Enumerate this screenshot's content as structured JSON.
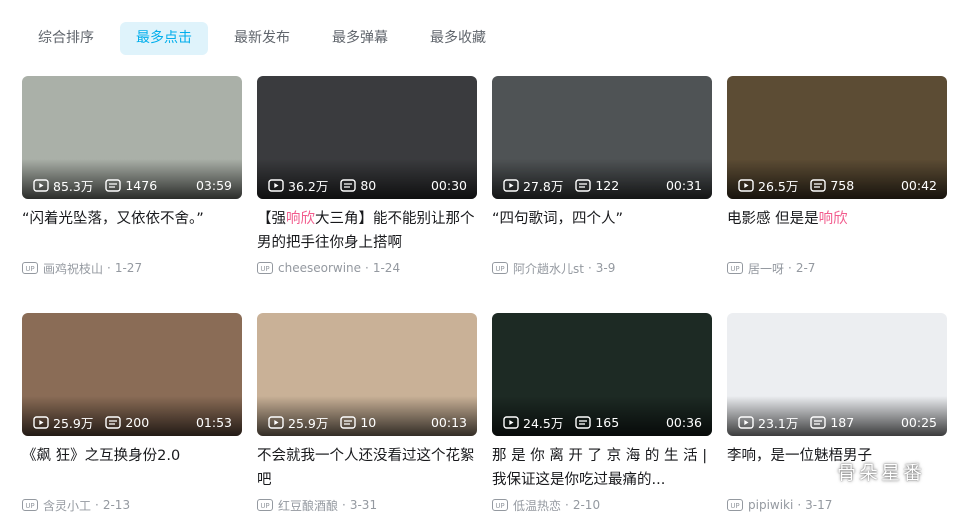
{
  "tabs": [
    "综合排序",
    "最多点击",
    "最新发布",
    "最多弹幕",
    "最多收藏"
  ],
  "active_tab": 1,
  "videos": [
    {
      "plays": "85.3万",
      "danmaku": "1476",
      "duration": "03:59",
      "title": [
        {
          "t": "“闪着光坠落，又依依不舍。”"
        }
      ],
      "author": "画鸡祝枝山",
      "date": "1-27",
      "art": "Ta"
    },
    {
      "plays": "36.2万",
      "danmaku": "80",
      "duration": "00:30",
      "title": [
        {
          "t": "【强"
        },
        {
          "t": "响欣",
          "hl": true
        },
        {
          "t": "大三角】能不能别让那个男的把手往你身上搭啊"
        }
      ],
      "author": "cheeseorwine",
      "date": "1-24",
      "art": "Tb"
    },
    {
      "plays": "27.8万",
      "danmaku": "122",
      "duration": "00:31",
      "title": [
        {
          "t": "“四句歌词，四个人”"
        }
      ],
      "author": "阿介趟水儿st",
      "date": "3-9",
      "art": "Tc"
    },
    {
      "plays": "26.5万",
      "danmaku": "758",
      "duration": "00:42",
      "title": [
        {
          "t": "电影感 但是是"
        },
        {
          "t": "响欣",
          "hl": true
        }
      ],
      "author": "居一呀",
      "date": "2-7",
      "art": "Td"
    },
    {
      "plays": "25.9万",
      "danmaku": "200",
      "duration": "01:53",
      "title": [
        {
          "t": "《飙 狂》之互换身份2.0"
        }
      ],
      "author": "含灵小工",
      "date": "2-13",
      "art": "Te"
    },
    {
      "plays": "25.9万",
      "danmaku": "10",
      "duration": "00:13",
      "title": [
        {
          "t": "不会就我一个人还没看过这个花絮吧"
        }
      ],
      "author": "红豆酿酒酿",
      "date": "3-31",
      "art": "Tf"
    },
    {
      "plays": "24.5万",
      "danmaku": "165",
      "duration": "00:36",
      "title": [
        {
          "t": "那 是 你 离 开 了 京 海 的 生 活 | 我保证这是你吃过最痛的..."
        }
      ],
      "author": "低温热恋",
      "date": "2-10",
      "art": "Tg"
    },
    {
      "plays": "23.1万",
      "danmaku": "187",
      "duration": "00:25",
      "title": [
        {
          "t": "李响，是一位魅梧男子"
        }
      ],
      "author": "pipiwiki",
      "date": "3-17",
      "art": "Th"
    }
  ],
  "up_badge": "UP",
  "watermark": "骨朵星番",
  "colors": {
    "accent": "#00aeec",
    "tab_active_bg": "#dff3fb",
    "highlight": "#f25d8e",
    "meta": "#9499a0"
  }
}
